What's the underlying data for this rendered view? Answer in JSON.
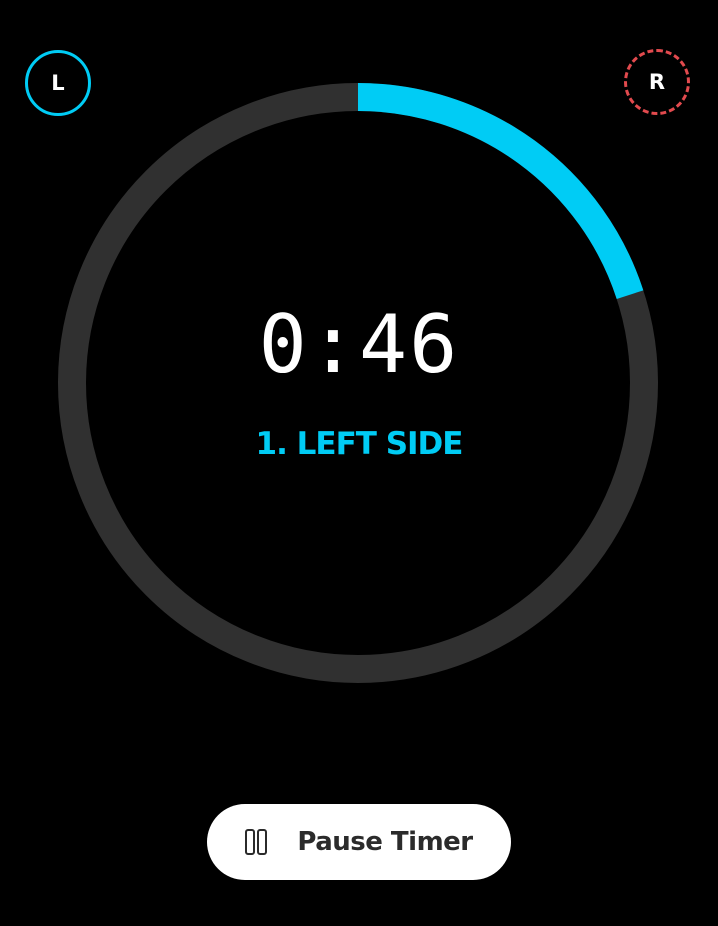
{
  "badges": {
    "left_label": "L",
    "right_label": "R"
  },
  "timer": {
    "time_display": "0:46",
    "side_label": "1. LEFT SIDE",
    "progress_fraction": 0.2
  },
  "controls": {
    "pause_label": "Pause Timer"
  },
  "colors": {
    "accent": "#00ccf5",
    "track": "#303030",
    "right_badge": "#e24a4e",
    "background": "#000000",
    "button_bg": "#ffffff",
    "button_text": "#2b2b2b"
  },
  "icons": {
    "pause": "pause-icon"
  }
}
